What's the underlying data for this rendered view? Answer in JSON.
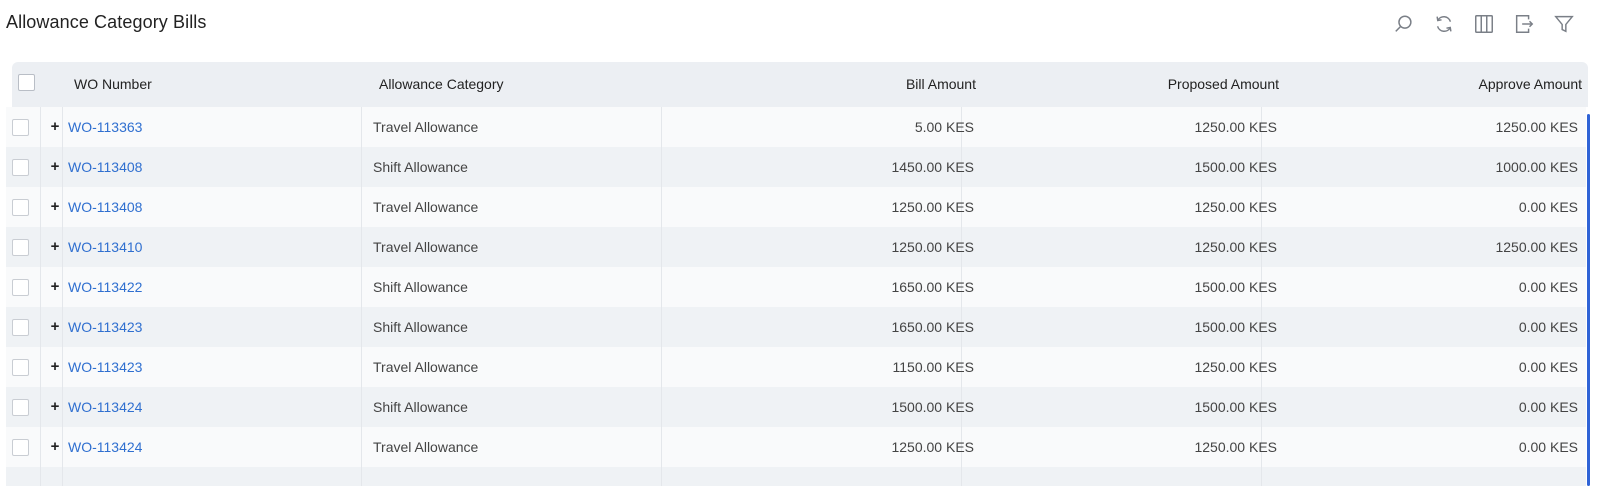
{
  "page": {
    "title": "Allowance Category Bills"
  },
  "toolbar": {
    "icons": [
      "search-icon",
      "refresh-icon",
      "columns-icon",
      "export-icon",
      "filter-icon"
    ]
  },
  "table": {
    "headers": {
      "wo_number": "WO Number",
      "allowance_category": "Allowance Category",
      "bill_amount": "Bill Amount",
      "proposed_amount": "Proposed Amount",
      "approve_amount": "Approve Amount"
    },
    "rows": [
      {
        "wo": "WO-113363",
        "category": "Travel Allowance",
        "bill": "5.00 KES",
        "proposed": "1250.00 KES",
        "approve": "1250.00 KES"
      },
      {
        "wo": "WO-113408",
        "category": "Shift Allowance",
        "bill": "1450.00 KES",
        "proposed": "1500.00 KES",
        "approve": "1000.00 KES"
      },
      {
        "wo": "WO-113408",
        "category": "Travel Allowance",
        "bill": "1250.00 KES",
        "proposed": "1250.00 KES",
        "approve": "0.00 KES"
      },
      {
        "wo": "WO-113410",
        "category": "Travel Allowance",
        "bill": "1250.00 KES",
        "proposed": "1250.00 KES",
        "approve": "1250.00 KES"
      },
      {
        "wo": "WO-113422",
        "category": "Shift Allowance",
        "bill": "1650.00 KES",
        "proposed": "1500.00 KES",
        "approve": "0.00 KES"
      },
      {
        "wo": "WO-113423",
        "category": "Shift Allowance",
        "bill": "1650.00 KES",
        "proposed": "1500.00 KES",
        "approve": "0.00 KES"
      },
      {
        "wo": "WO-113423",
        "category": "Travel Allowance",
        "bill": "1150.00 KES",
        "proposed": "1250.00 KES",
        "approve": "0.00 KES"
      },
      {
        "wo": "WO-113424",
        "category": "Shift Allowance",
        "bill": "1500.00 KES",
        "proposed": "1500.00 KES",
        "approve": "0.00 KES"
      },
      {
        "wo": "WO-113424",
        "category": "Travel Allowance",
        "bill": "1250.00 KES",
        "proposed": "1250.00 KES",
        "approve": "0.00 KES"
      }
    ],
    "expand_symbol": "+"
  },
  "colors": {
    "link": "#2f6fd0",
    "header_bg": "#eceff3",
    "row_odd": "#f9fafb",
    "row_even": "#eff2f5",
    "scroll_indicator": "#2f63d6"
  }
}
